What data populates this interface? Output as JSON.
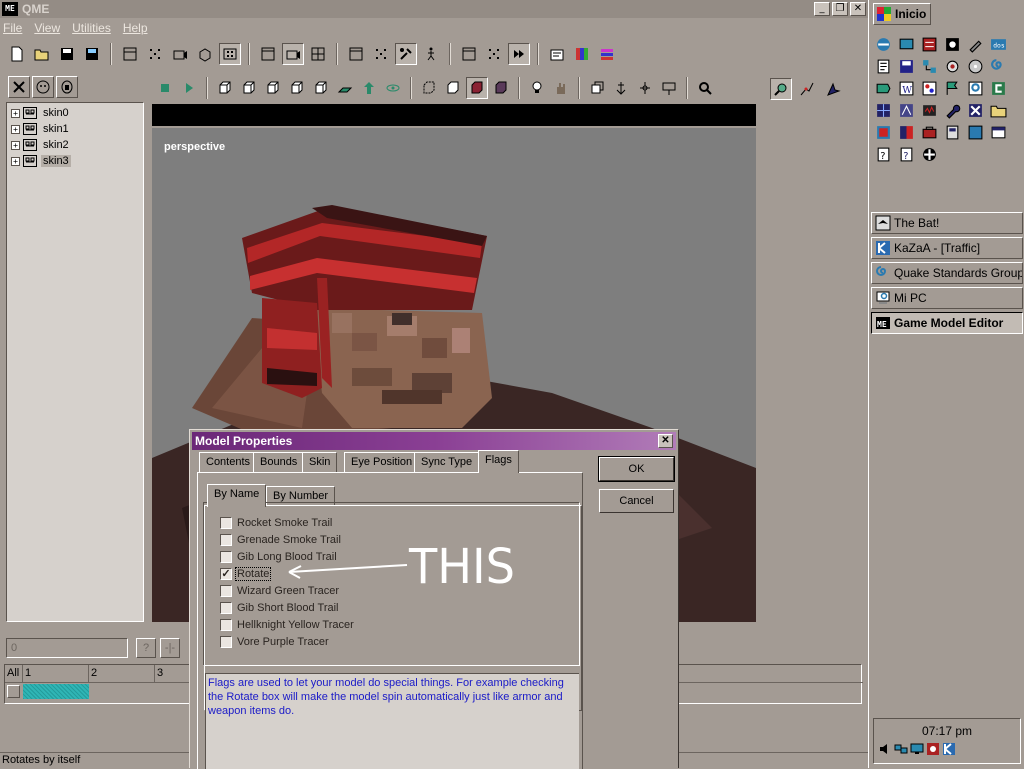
{
  "window": {
    "title": "QME",
    "app_icon_text": "ME"
  },
  "menu": [
    "File",
    "View",
    "Utilities",
    "Help"
  ],
  "tree": {
    "items": [
      {
        "label": "skin0",
        "selected": false
      },
      {
        "label": "skin1",
        "selected": false
      },
      {
        "label": "skin2",
        "selected": false
      },
      {
        "label": "skin3",
        "selected": true
      }
    ]
  },
  "viewport": {
    "label": "perspective"
  },
  "timeline": {
    "input_value": "0",
    "btn1": "?",
    "btn2": "-|-",
    "header_all": "All",
    "frames": [
      "1",
      "2",
      "3"
    ]
  },
  "status": {
    "text": "Rotates by itself"
  },
  "dialog": {
    "title": "Model Properties",
    "close": "✕",
    "tabs": [
      "Contents",
      "Bounds",
      "Skin",
      "Eye Position",
      "Sync Type",
      "Flags"
    ],
    "active_tab": "Flags",
    "subtabs": [
      "By Name",
      "By Number"
    ],
    "active_subtab": "By Name",
    "flags": [
      {
        "label": "Rocket Smoke Trail",
        "checked": false
      },
      {
        "label": "Grenade Smoke Trail",
        "checked": false
      },
      {
        "label": "Gib Long Blood Trail",
        "checked": false
      },
      {
        "label": "Rotate",
        "checked": true
      },
      {
        "label": "Wizard Green Tracer",
        "checked": false
      },
      {
        "label": "Gib Short Blood Trail",
        "checked": false
      },
      {
        "label": "Hellknight Yellow Tracer",
        "checked": false
      },
      {
        "label": "Vore Purple Tracer",
        "checked": false
      }
    ],
    "description": "Flags are used to let your model do special things. For example checking the Rotate box will make the model spin automatically just like armor and weapon items do.",
    "ok_label": "OK",
    "cancel_label": "Cancel"
  },
  "annotation": {
    "text": "THIS",
    "color": "#ffffff"
  },
  "taskbar": {
    "start_label": "Inicio",
    "tasks": [
      {
        "label": "The Bat!",
        "icon": "bat-icon",
        "active": false
      },
      {
        "label": "KaZaA - [Traffic]",
        "icon": "kazaa-icon",
        "active": false
      },
      {
        "label": "Quake Standards Group...",
        "icon": "browser-icon",
        "active": false
      },
      {
        "label": "Mi PC",
        "icon": "computer-icon",
        "active": false
      },
      {
        "label": "Game Model Editor",
        "icon": "qme-icon",
        "active": true
      }
    ],
    "clock": "07:17 pm"
  },
  "colors": {
    "face": "#a39b94",
    "title_active_start": "#6b2878",
    "title_active_end": "#b17cb8",
    "viewport_bg": "#7e7e7e",
    "description_text": "#1a1ac8",
    "timeline_frame": "#2fb5b5"
  }
}
